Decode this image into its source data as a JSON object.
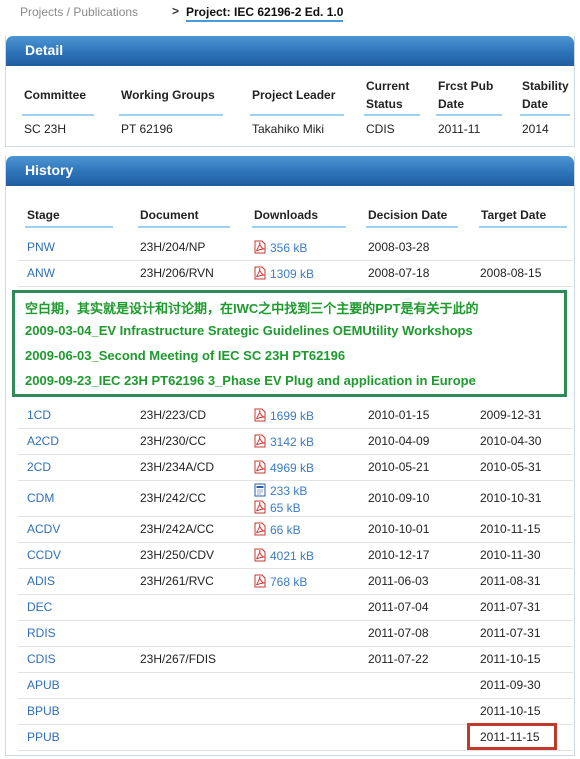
{
  "breadcrumb": {
    "link": "Projects / Publications",
    "separator": ">",
    "current": "Project: IEC 62196-2 Ed. 1.0"
  },
  "detail": {
    "title": "Detail",
    "headers": {
      "committee": "Committee",
      "working_groups": "Working Groups",
      "project_leader": "Project Leader",
      "current_status_1": "Current",
      "current_status_2": "Status",
      "frcst_pub_1": "Frcst Pub",
      "frcst_pub_2": "Date",
      "stability_1": "Stability",
      "stability_2": "Date"
    },
    "values": {
      "committee": "SC 23H",
      "working_groups": "PT 62196",
      "project_leader": "Takahiko Miki",
      "current_status": "CDIS",
      "frcst_pub": "2011-11",
      "stability": "2014"
    }
  },
  "history": {
    "title": "History",
    "headers": {
      "stage": "Stage",
      "document": "Document",
      "downloads": "Downloads",
      "decision_date": "Decision Date",
      "target_date": "Target Date"
    },
    "rows_top": [
      {
        "stage": "PNW",
        "document": "23H/204/NP",
        "download": "356 kB",
        "decision": "2008-03-28",
        "target": ""
      },
      {
        "stage": "ANW",
        "document": "23H/206/RVN",
        "download": "1309 kB",
        "decision": "2008-07-18",
        "target": "2008-08-15"
      }
    ],
    "rows_bottom": [
      {
        "stage": "1CD",
        "document": "23H/223/CD",
        "download": "1699 kB",
        "decision": "2010-01-15",
        "target": "2009-12-31"
      },
      {
        "stage": "A2CD",
        "document": "23H/230/CC",
        "download": "3142 kB",
        "decision": "2010-04-09",
        "target": "2010-04-30"
      },
      {
        "stage": "2CD",
        "document": "23H/234A/CD",
        "download": "4969 kB",
        "decision": "2010-05-21",
        "target": "2010-05-31"
      },
      {
        "stage": "CDM",
        "document": "23H/242/CC",
        "download": "233 kB",
        "download2": "65 kB",
        "decision": "2010-09-10",
        "target": "2010-10-31"
      },
      {
        "stage": "ACDV",
        "document": "23H/242A/CC",
        "download": "66 kB",
        "decision": "2010-10-01",
        "target": "2010-11-15"
      },
      {
        "stage": "CCDV",
        "document": "23H/250/CDV",
        "download": "4021 kB",
        "decision": "2010-12-17",
        "target": "2010-11-30"
      },
      {
        "stage": "ADIS",
        "document": "23H/261/RVC",
        "download": "768 kB",
        "decision": "2011-06-03",
        "target": "2011-08-31"
      },
      {
        "stage": "DEC",
        "document": "",
        "download": "",
        "decision": "2011-07-04",
        "target": "2011-07-31"
      },
      {
        "stage": "RDIS",
        "document": "",
        "download": "",
        "decision": "2011-07-08",
        "target": "2011-07-31"
      },
      {
        "stage": "CDIS",
        "document": "23H/267/FDIS",
        "download": "",
        "decision": "2011-07-22",
        "target": "2011-10-15"
      },
      {
        "stage": "APUB",
        "document": "",
        "download": "",
        "decision": "",
        "target": "2011-09-30"
      },
      {
        "stage": "BPUB",
        "document": "",
        "download": "",
        "decision": "",
        "target": "2011-10-15"
      },
      {
        "stage": "PPUB",
        "document": "",
        "download": "",
        "decision": "",
        "target": "2011-11-15"
      }
    ]
  },
  "annotation": {
    "line1": "空白期，其实就是设计和讨论期，在IWC之中找到三个主要的PPT是有关于此的",
    "line2": "2009-03-04_EV Infrastructure Srategic Guidelines OEMUtility Workshops",
    "line3": "2009-06-03_Second Meeting of IEC SC 23H PT62196",
    "line4": "2009-09-23_IEC 23H PT62196 3_Phase EV Plug and application in Europe",
    "color": "#1e9a2e",
    "border_color": "#2e8b57"
  },
  "highlight": {
    "color": "#c0392b"
  },
  "icons": {
    "pdf": "pdf-icon",
    "doc": "doc-icon"
  }
}
